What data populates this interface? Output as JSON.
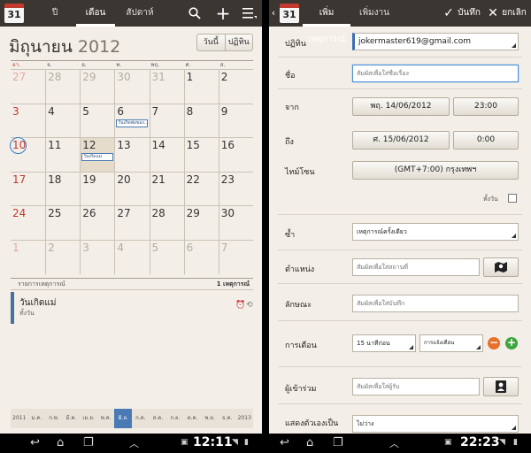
{
  "left": {
    "tabs": [
      "ปี",
      "เดือน",
      "สัปดาห์"
    ],
    "month_name": "มิถุนายน",
    "year": "2012",
    "today_btn": "วันนี้",
    "agenda_btn": "ปฏิทิน",
    "dow": [
      "อา.",
      "จ.",
      "อ.",
      "พ.",
      "พฤ.",
      "ศ.",
      "ส."
    ],
    "weeks": [
      [
        "27",
        "28",
        "29",
        "30",
        "31",
        "1",
        "2"
      ],
      [
        "3",
        "4",
        "5",
        "6",
        "7",
        "8",
        "9"
      ],
      [
        "10",
        "11",
        "12",
        "13",
        "14",
        "15",
        "16"
      ],
      [
        "17",
        "18",
        "19",
        "20",
        "21",
        "22",
        "23"
      ],
      [
        "24",
        "25",
        "26",
        "27",
        "28",
        "29",
        "30"
      ],
      [
        "1",
        "2",
        "3",
        "4",
        "5",
        "6",
        "7"
      ]
    ],
    "event_w2d3": "วันเกิดพ่อของ...",
    "event_w3d2": "วันเกิดแม่",
    "events_header": "รายการเหตุการณ์",
    "events_count": "1 เหตุการณ์",
    "event_title": "วันเกิดแม่",
    "event_sub": "ทั้งวัน",
    "months": [
      "2011",
      "ม.ค.",
      "ก.พ.",
      "มี.ค.",
      "เม.ย.",
      "พ.ค.",
      "มิ.ย.",
      "ก.ค.",
      "ส.ค.",
      "ก.ย.",
      "ต.ค.",
      "พ.ย.",
      "ธ.ค.",
      "2013"
    ],
    "time": "12:11"
  },
  "right": {
    "tabs": [
      "เพิ่มเหตุการณ์",
      "เพิ่มงาน"
    ],
    "save": "บันทึก",
    "cancel": "ยกเลิก",
    "calendar_label": "ปฏิทิน",
    "calendar_value": "jokermaster619@gmail.com",
    "title_label": "ชื่อ",
    "title_placeholder": "สัมผัสเพื่อใส่ชื่อเรื่อง",
    "from_label": "จาก",
    "from_date": "พฤ. 14/06/2012",
    "from_time": "23:00",
    "to_label": "ถึง",
    "to_date": "ศ. 15/06/2012",
    "to_time": "0:00",
    "tz_label": "ไทม์โซน",
    "tz_value": "(GMT+7:00) กรุงเทพฯ",
    "allday_label": "ทั้งวัน",
    "repeat_label": "ซ้ำ",
    "repeat_value": "เหตุการณ์ครั้งเดียว",
    "location_label": "ตำแหน่ง",
    "location_placeholder": "สัมผัสเพื่อใส่สถานที่",
    "desc_label": "ลักษณะ",
    "desc_placeholder": "สัมผัสเพื่อใส่บันทึก",
    "reminder_label": "การเตือน",
    "reminder_value": "15 นาทีก่อน",
    "reminder_type": "การแจ้งเตือน",
    "guests_label": "ผู้เข้าร่วม",
    "guests_placeholder": "สัมผัสเพื่อใส่ผู้รับ",
    "showme_label": "แสดงตัวเองเป็น",
    "showme_value": "ไม่ว่าง",
    "time": "22:23"
  }
}
